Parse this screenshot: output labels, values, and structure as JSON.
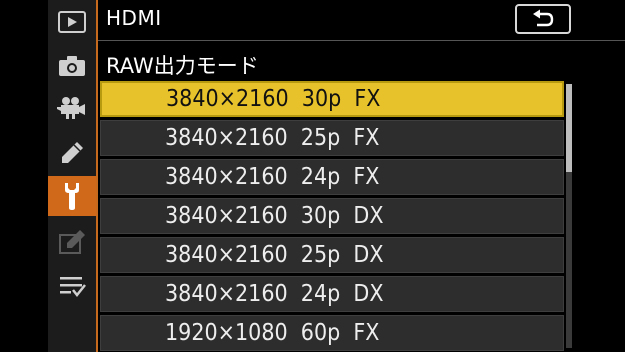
{
  "header": {
    "title": "HDMI",
    "subtitle": "RAW出力モード"
  },
  "tabs": [
    {
      "icon": "playback-icon",
      "active": false
    },
    {
      "icon": "camera-icon",
      "active": false
    },
    {
      "icon": "movie-camera-icon",
      "active": false
    },
    {
      "icon": "pencil-icon",
      "active": false
    },
    {
      "icon": "wrench-icon",
      "active": true
    },
    {
      "icon": "retouch-icon",
      "active": false
    },
    {
      "icon": "my-menu-icon",
      "active": false
    }
  ],
  "list": {
    "items": [
      {
        "label": "3840×2160  30p  FX",
        "selected": true
      },
      {
        "label": "3840×2160  25p  FX",
        "selected": false
      },
      {
        "label": "3840×2160  24p  FX",
        "selected": false
      },
      {
        "label": "3840×2160  30p  DX",
        "selected": false
      },
      {
        "label": "3840×2160  25p  DX",
        "selected": false
      },
      {
        "label": "3840×2160  24p  DX",
        "selected": false
      },
      {
        "label": "1920×1080  60p  FX",
        "selected": false
      }
    ],
    "scroll_fraction_visible": 0.33
  },
  "colors": {
    "selection": "#e8c22a",
    "active_tab": "#d06a1a",
    "row": "#2d2d2d"
  }
}
